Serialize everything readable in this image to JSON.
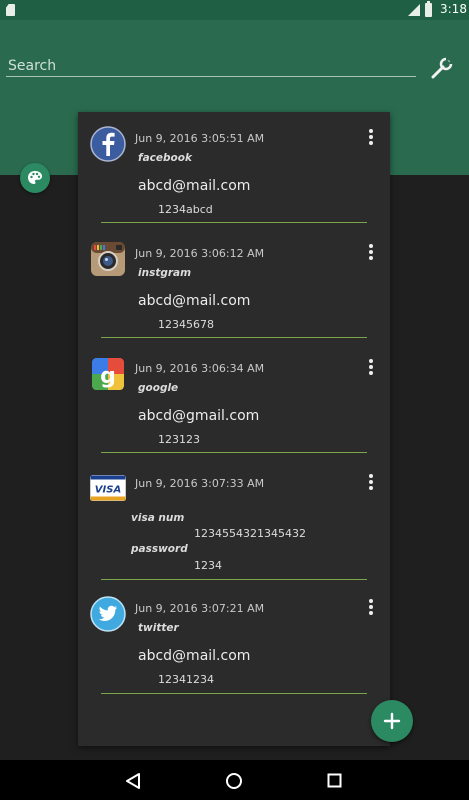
{
  "status_bar": {
    "time": "3:18"
  },
  "search": {
    "placeholder": "Search"
  },
  "entries": [
    {
      "icon": "facebook-logo",
      "date": "Jun 9, 2016 3:05:51 AM",
      "name": "facebook",
      "email": "abcd@mail.com",
      "password": "1234abcd"
    },
    {
      "icon": "instagram-logo",
      "date": "Jun 9, 2016 3:06:12 AM",
      "name": "instgram",
      "email": "abcd@mail.com",
      "password": "12345678"
    },
    {
      "icon": "google-logo",
      "date": "Jun 9, 2016 3:06:34 AM",
      "name": "google",
      "email": "abcd@gmail.com",
      "password": "123123"
    },
    {
      "icon": "visa-logo",
      "date": "Jun 9, 2016 3:07:33 AM",
      "visa_num_label": "visa num",
      "visa_num": "1234554321345432",
      "password_label": "password",
      "password": "1234"
    },
    {
      "icon": "twitter-logo",
      "date": "Jun 9, 2016 3:07:21 AM",
      "name": "twitter",
      "email": "abcd@mail.com",
      "password": "12341234"
    }
  ],
  "colors": {
    "header": "#2a6b4f",
    "status_bar": "#1f5f43",
    "accent": "#2c8a63",
    "divider": "#7aa548",
    "card": "#2b2b2b"
  }
}
